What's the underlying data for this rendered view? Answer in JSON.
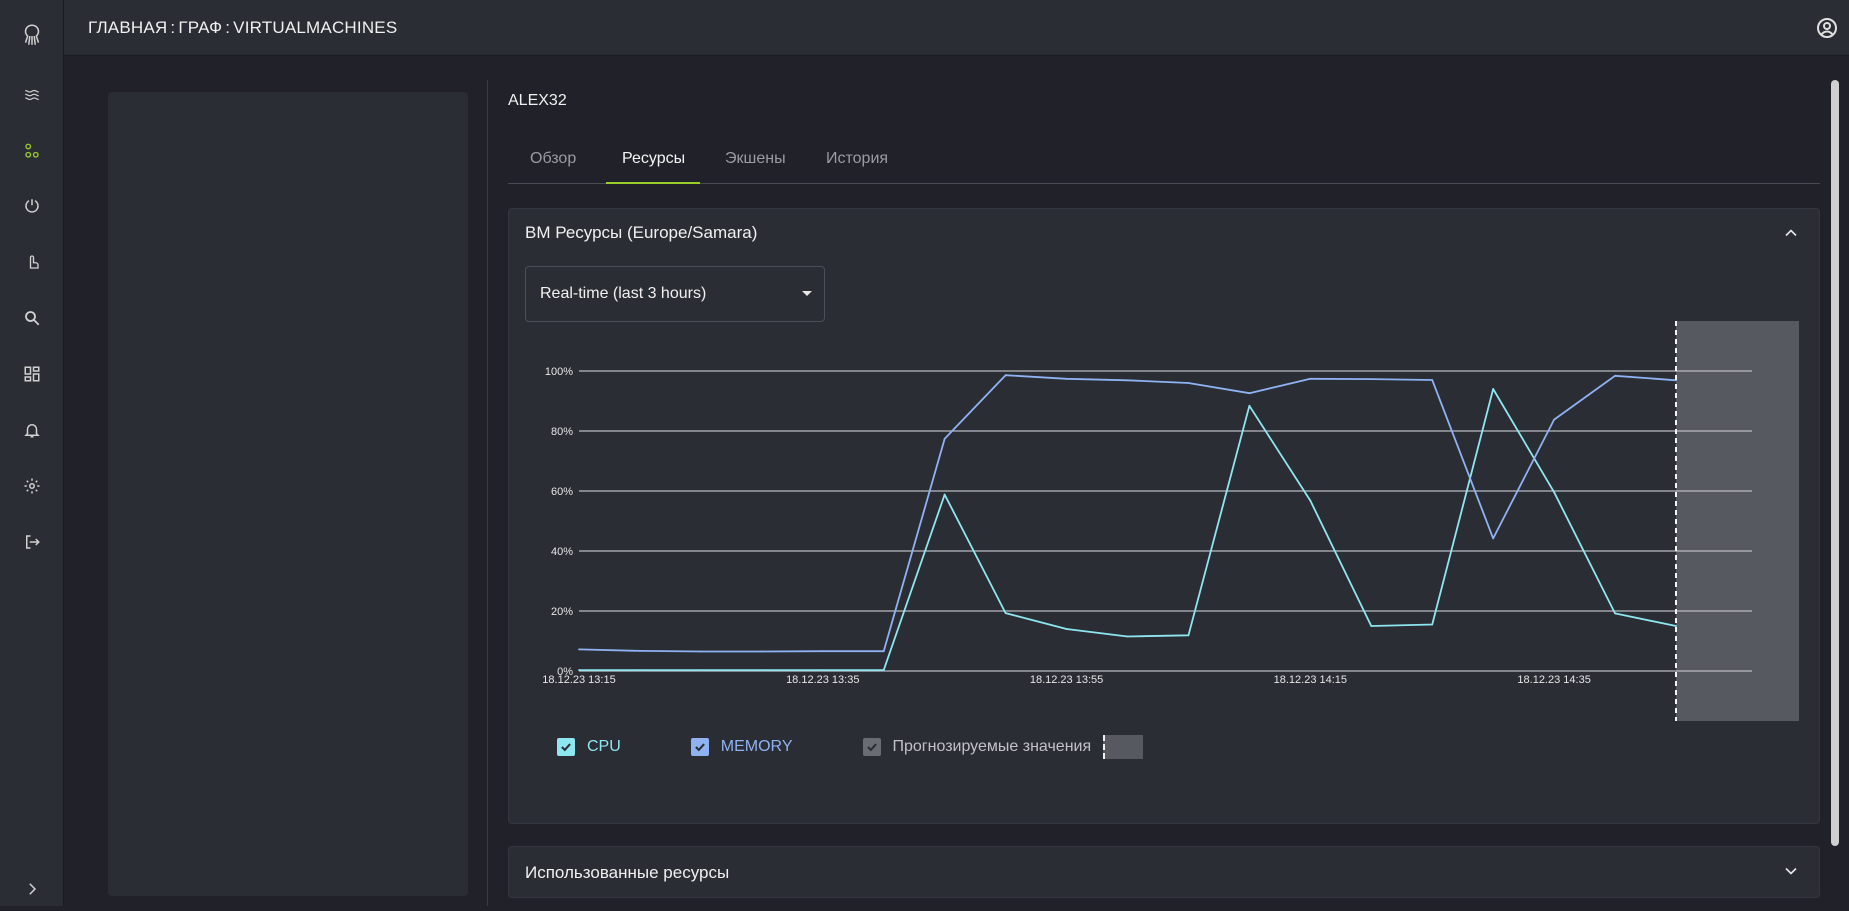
{
  "header": {
    "breadcrumb": [
      "ГЛАВНАЯ",
      "ГРАФ",
      "VIRTUALMACHINES"
    ],
    "separator": ":"
  },
  "sidebar": {
    "items": [
      {
        "icon": "kraken-logo-icon"
      },
      {
        "icon": "waves-icon"
      },
      {
        "icon": "graph-icon",
        "active": true
      },
      {
        "icon": "power-icon"
      },
      {
        "icon": "pointer-icon"
      },
      {
        "icon": "search-icon"
      },
      {
        "icon": "dashboard-icon"
      },
      {
        "icon": "bell-icon"
      },
      {
        "icon": "gear-icon"
      },
      {
        "icon": "logout-icon"
      },
      {
        "icon": "chevron-right-icon"
      }
    ],
    "active_color": "#9ccc2c"
  },
  "vm": {
    "title": "ALEX32",
    "tabs": [
      "Обзор",
      "Ресурсы",
      "Экшены",
      "История"
    ],
    "active_tab": "Ресурсы"
  },
  "resources_card": {
    "title": "ВМ Ресурсы (Europe/Samara)",
    "period_select": "Real-time (last 3 hours)"
  },
  "legend": {
    "cpu": "CPU",
    "memory": "MEMORY",
    "forecast": "Прогнозируемые значения"
  },
  "used_resources_card": {
    "title": "Использованные ресурсы"
  },
  "colors": {
    "cpu": "#8ee6f0",
    "memory": "#8fb2f2",
    "accent": "#9ccc2c"
  },
  "chart_data": {
    "type": "line",
    "y_tick_labels": [
      "0%",
      "20%",
      "40%",
      "60%",
      "80%",
      "100%"
    ],
    "x_tick_labels": [
      "18.12.23 13:15",
      "18.12.23 13:35",
      "18.12.23 13:55",
      "18.12.23 14:15",
      "18.12.23 14:35"
    ],
    "x": [
      "13:15",
      "13:20",
      "13:25",
      "13:30",
      "13:35",
      "13:40",
      "13:45",
      "13:50",
      "13:55",
      "14:00",
      "14:05",
      "14:10",
      "14:15",
      "14:20",
      "14:25",
      "14:30",
      "14:35",
      "14:40",
      "14:45",
      "14:50"
    ],
    "ylim": [
      0,
      100
    ],
    "forecast_start": "14:45",
    "grid": true,
    "series": [
      {
        "name": "CPU",
        "values": [
          0.3,
          0.3,
          0.3,
          0.3,
          0.3,
          0.3,
          58.8,
          19.3,
          14,
          11.5,
          11.9,
          88.4,
          56.8,
          15,
          15.5,
          94,
          59.6,
          19.2,
          15
        ]
      },
      {
        "name": "MEMORY",
        "values": [
          7.2,
          6.7,
          6.5,
          6.5,
          6.6,
          6.6,
          77.4,
          98.6,
          97.4,
          96.9,
          96,
          92.6,
          97.4,
          97.3,
          97,
          44.2,
          83.8,
          98.4,
          96.9
        ]
      }
    ]
  }
}
